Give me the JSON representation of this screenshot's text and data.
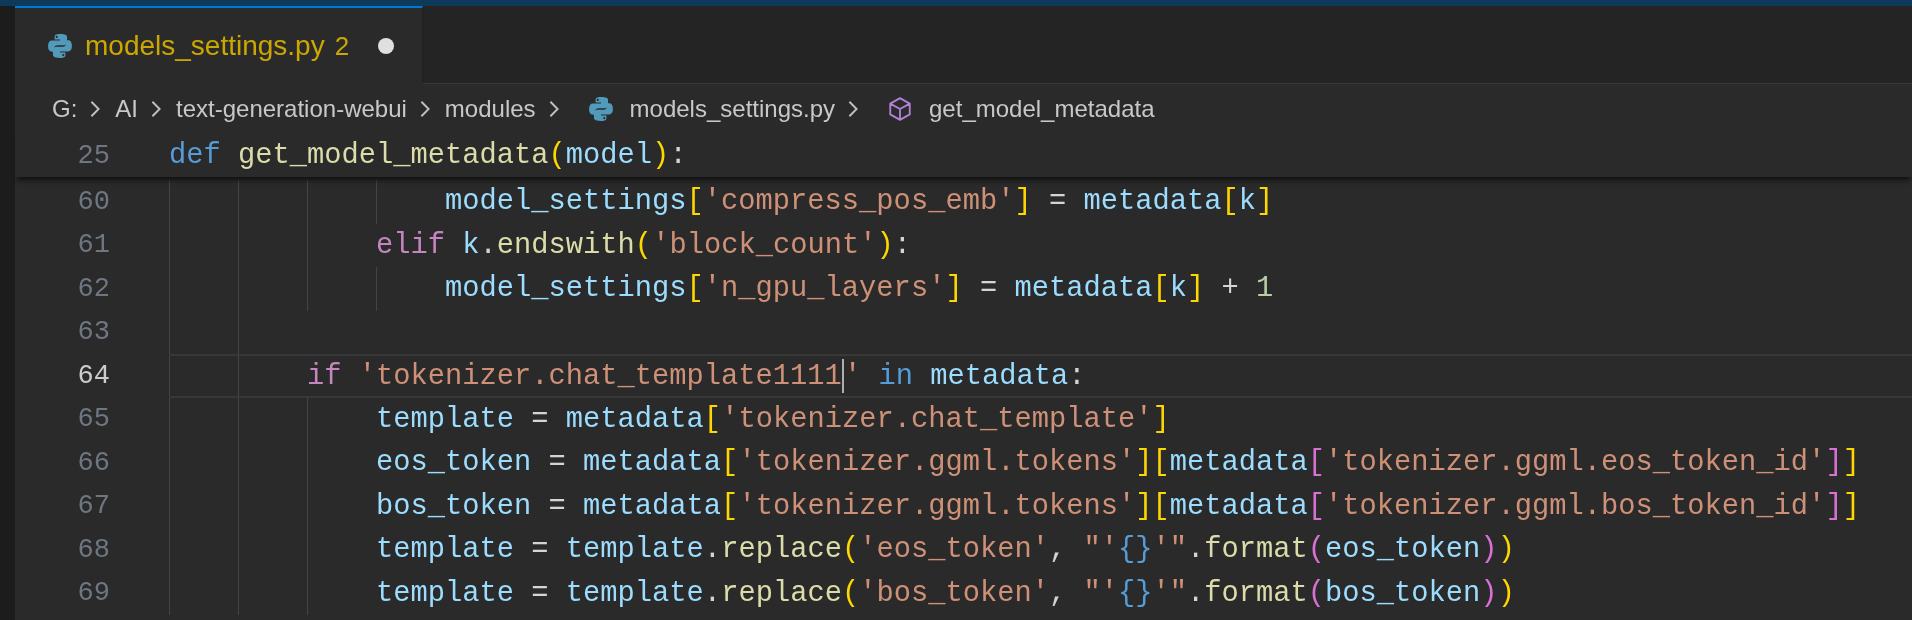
{
  "tab": {
    "filename": "models_settings.py",
    "problem_count": "2",
    "modified": true,
    "selected": true
  },
  "breadcrumbs": [
    {
      "label": "G:",
      "kind": "folder"
    },
    {
      "label": "AI",
      "kind": "folder"
    },
    {
      "label": "text-generation-webui",
      "kind": "folder"
    },
    {
      "label": "modules",
      "kind": "folder"
    },
    {
      "label": "models_settings.py",
      "kind": "python-file"
    },
    {
      "label": "get_model_metadata",
      "kind": "method"
    }
  ],
  "sticky_line": {
    "number": "25",
    "tokens": [
      {
        "text": "def ",
        "kind": "storage"
      },
      {
        "text": "get_model_metadata",
        "kind": "function"
      },
      {
        "text": "(",
        "kind": "bracket1"
      },
      {
        "text": "model",
        "kind": "variable"
      },
      {
        "text": ")",
        "kind": "bracket1"
      },
      {
        "text": ":",
        "kind": "plain"
      }
    ]
  },
  "lines": [
    {
      "number": "60",
      "current": false,
      "tokens": [
        {
          "text": "                model_settings",
          "kind": "variable"
        },
        {
          "text": "[",
          "kind": "bracket1"
        },
        {
          "text": "'compress_pos_emb'",
          "kind": "string"
        },
        {
          "text": "]",
          "kind": "bracket1"
        },
        {
          "text": " = ",
          "kind": "plain"
        },
        {
          "text": "metadata",
          "kind": "variable"
        },
        {
          "text": "[",
          "kind": "bracket1"
        },
        {
          "text": "k",
          "kind": "variable"
        },
        {
          "text": "]",
          "kind": "bracket1"
        }
      ]
    },
    {
      "number": "61",
      "current": false,
      "tokens": [
        {
          "text": "            elif ",
          "kind": "control"
        },
        {
          "text": "k",
          "kind": "variable"
        },
        {
          "text": ".",
          "kind": "plain"
        },
        {
          "text": "endswith",
          "kind": "function"
        },
        {
          "text": "(",
          "kind": "bracket1"
        },
        {
          "text": "'block_count'",
          "kind": "string"
        },
        {
          "text": ")",
          "kind": "bracket1"
        },
        {
          "text": ":",
          "kind": "plain"
        }
      ]
    },
    {
      "number": "62",
      "current": false,
      "tokens": [
        {
          "text": "                model_settings",
          "kind": "variable"
        },
        {
          "text": "[",
          "kind": "bracket1"
        },
        {
          "text": "'n_gpu_layers'",
          "kind": "string"
        },
        {
          "text": "]",
          "kind": "bracket1"
        },
        {
          "text": " = ",
          "kind": "plain"
        },
        {
          "text": "metadata",
          "kind": "variable"
        },
        {
          "text": "[",
          "kind": "bracket1"
        },
        {
          "text": "k",
          "kind": "variable"
        },
        {
          "text": "]",
          "kind": "bracket1"
        },
        {
          "text": " + ",
          "kind": "plain"
        },
        {
          "text": "1",
          "kind": "number"
        }
      ]
    },
    {
      "number": "63",
      "current": false
    },
    {
      "number": "64",
      "current": true,
      "tokens": [
        {
          "text": "        if ",
          "kind": "control"
        },
        {
          "text": "'tokenizer.chat_template1111",
          "kind": "string",
          "caret_after": true
        },
        {
          "text": "'",
          "kind": "string"
        },
        {
          "text": " in ",
          "kind": "storage"
        },
        {
          "text": "metadata",
          "kind": "variable"
        },
        {
          "text": ":",
          "kind": "plain"
        }
      ]
    },
    {
      "number": "65",
      "current": false,
      "tokens": [
        {
          "text": "            template",
          "kind": "variable"
        },
        {
          "text": " = ",
          "kind": "plain"
        },
        {
          "text": "metadata",
          "kind": "variable"
        },
        {
          "text": "[",
          "kind": "bracket1"
        },
        {
          "text": "'tokenizer.chat_template'",
          "kind": "string"
        },
        {
          "text": "]",
          "kind": "bracket1"
        }
      ]
    },
    {
      "number": "66",
      "current": false,
      "tokens": [
        {
          "text": "            eos_token",
          "kind": "variable"
        },
        {
          "text": " = ",
          "kind": "plain"
        },
        {
          "text": "metadata",
          "kind": "variable"
        },
        {
          "text": "[",
          "kind": "bracket1"
        },
        {
          "text": "'tokenizer.ggml.tokens'",
          "kind": "string"
        },
        {
          "text": "]",
          "kind": "bracket1"
        },
        {
          "text": "[",
          "kind": "bracket1"
        },
        {
          "text": "metadata",
          "kind": "variable"
        },
        {
          "text": "[",
          "kind": "bracket2"
        },
        {
          "text": "'tokenizer.ggml.eos_token_id'",
          "kind": "string"
        },
        {
          "text": "]",
          "kind": "bracket2"
        },
        {
          "text": "]",
          "kind": "bracket1"
        }
      ]
    },
    {
      "number": "67",
      "current": false,
      "tokens": [
        {
          "text": "            bos_token",
          "kind": "variable"
        },
        {
          "text": " = ",
          "kind": "plain"
        },
        {
          "text": "metadata",
          "kind": "variable"
        },
        {
          "text": "[",
          "kind": "bracket1"
        },
        {
          "text": "'tokenizer.ggml.tokens'",
          "kind": "string"
        },
        {
          "text": "]",
          "kind": "bracket1"
        },
        {
          "text": "[",
          "kind": "bracket1"
        },
        {
          "text": "metadata",
          "kind": "variable"
        },
        {
          "text": "[",
          "kind": "bracket2"
        },
        {
          "text": "'tokenizer.ggml.bos_token_id'",
          "kind": "string"
        },
        {
          "text": "]",
          "kind": "bracket2"
        },
        {
          "text": "]",
          "kind": "bracket1"
        }
      ]
    },
    {
      "number": "68",
      "current": false,
      "tokens": [
        {
          "text": "            template",
          "kind": "variable"
        },
        {
          "text": " = ",
          "kind": "plain"
        },
        {
          "text": "template",
          "kind": "variable"
        },
        {
          "text": ".",
          "kind": "plain"
        },
        {
          "text": "replace",
          "kind": "function"
        },
        {
          "text": "(",
          "kind": "bracket1"
        },
        {
          "text": "'eos_token'",
          "kind": "string"
        },
        {
          "text": ", ",
          "kind": "plain"
        },
        {
          "text": "\"'",
          "kind": "string"
        },
        {
          "text": "{}",
          "kind": "placeholder"
        },
        {
          "text": "'\"",
          "kind": "string"
        },
        {
          "text": ".",
          "kind": "plain"
        },
        {
          "text": "format",
          "kind": "function"
        },
        {
          "text": "(",
          "kind": "bracket2"
        },
        {
          "text": "eos_token",
          "kind": "variable"
        },
        {
          "text": ")",
          "kind": "bracket2"
        },
        {
          "text": ")",
          "kind": "bracket1"
        }
      ]
    },
    {
      "number": "69",
      "current": false,
      "tokens": [
        {
          "text": "            template",
          "kind": "variable"
        },
        {
          "text": " = ",
          "kind": "plain"
        },
        {
          "text": "template",
          "kind": "variable"
        },
        {
          "text": ".",
          "kind": "plain"
        },
        {
          "text": "replace",
          "kind": "function"
        },
        {
          "text": "(",
          "kind": "bracket1"
        },
        {
          "text": "'bos_token'",
          "kind": "string"
        },
        {
          "text": ", ",
          "kind": "plain"
        },
        {
          "text": "\"'",
          "kind": "string"
        },
        {
          "text": "{}",
          "kind": "placeholder"
        },
        {
          "text": "'\"",
          "kind": "string"
        },
        {
          "text": ".",
          "kind": "plain"
        },
        {
          "text": "format",
          "kind": "function"
        },
        {
          "text": "(",
          "kind": "bracket2"
        },
        {
          "text": "bos_token",
          "kind": "variable"
        },
        {
          "text": ")",
          "kind": "bracket2"
        },
        {
          "text": ")",
          "kind": "bracket1"
        }
      ]
    }
  ]
}
